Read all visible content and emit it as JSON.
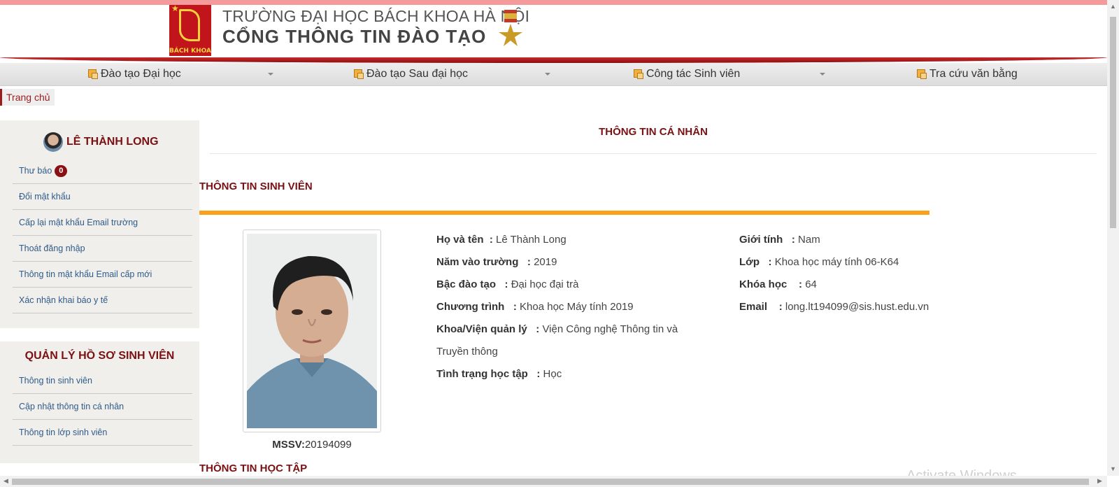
{
  "header": {
    "logo_text": "BÁCH KHOA",
    "title_line1": "TRƯỜNG ĐẠI HỌC BÁCH KHOA HÀ NỘI",
    "title_line2": "CỔNG THÔNG TIN ĐÀO TẠO"
  },
  "nav": {
    "items": [
      {
        "label": "Đào tạo Đại học"
      },
      {
        "label": "Đào tạo Sau đại học"
      },
      {
        "label": "Công tác Sinh viên"
      },
      {
        "label": "Tra cứu văn bằng"
      }
    ]
  },
  "breadcrumb": {
    "home": "Trang chủ"
  },
  "sidebar": {
    "user_name": "LÊ THÀNH LONG",
    "links": [
      {
        "label": "Thư báo",
        "badge": "0"
      },
      {
        "label": "Đổi mật khẩu"
      },
      {
        "label": "Cấp lại mật khẩu Email trường"
      },
      {
        "label": "Thoát đăng nhập"
      },
      {
        "label": "Thông tin mật khẩu Email cấp mới"
      },
      {
        "label": "Xác nhận khai báo y tế"
      }
    ],
    "records_title": "QUẢN LÝ HỒ SƠ SINH VIÊN",
    "records_links": [
      {
        "label": "Thông tin sinh viên"
      },
      {
        "label": "Cập nhật thông tin cá nhân"
      },
      {
        "label": "Thông tin lớp sinh viên"
      }
    ]
  },
  "main": {
    "page_title": "THÔNG TIN CÁ NHÂN",
    "section_student": "THÔNG TIN SINH VIÊN",
    "section_study": "THÔNG TIN HỌC TẬP",
    "mssv_label": "MSSV:",
    "mssv_value": "20194099",
    "left_fields": [
      {
        "label": "Họ và tên",
        "value": "Lê Thành Long"
      },
      {
        "label": "Năm vào trường",
        "value": "2019"
      },
      {
        "label": "Bậc đào tạo",
        "value": "Đại học đại trà"
      },
      {
        "label": "Chương trình",
        "value": "Khoa học Máy tính 2019"
      },
      {
        "label": "Khoa/Viện quản lý",
        "value": "Viện Công nghệ Thông tin và",
        "value_cont": "Truyền thông"
      },
      {
        "label": "Tình trạng học tập",
        "value": "Học"
      }
    ],
    "right_fields": [
      {
        "label": "Giới tính",
        "value": "Nam"
      },
      {
        "label": "Lớp",
        "value": "Khoa học máy tính 06-K64"
      },
      {
        "label": "Khóa học",
        "value": "64"
      },
      {
        "label": "Email",
        "value": "long.lt194099@sis.hust.edu.vn"
      }
    ]
  },
  "watermark": "Activate Windows"
}
